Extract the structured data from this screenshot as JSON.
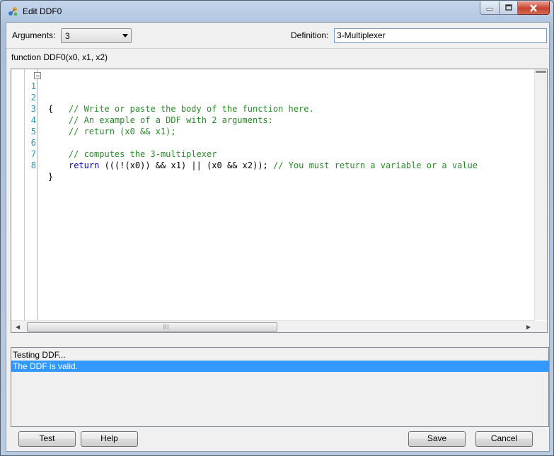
{
  "window": {
    "title": "Edit DDF0"
  },
  "arguments": {
    "label": "Arguments:",
    "value": "3"
  },
  "definition": {
    "label": "Definition:",
    "value": "3-Multiplexer"
  },
  "signature": "function DDF0(x0, x1, x2)",
  "editor": {
    "lines": [
      {
        "num": "1",
        "text": "{"
      },
      {
        "num": "2",
        "text": "    // Write or paste the body of the function here."
      },
      {
        "num": "3",
        "text": "    // An example of a DDF with 2 arguments:"
      },
      {
        "num": "4",
        "text": "    // return (x0 && x1);"
      },
      {
        "num": "5",
        "text": ""
      },
      {
        "num": "6",
        "text": "    // computes the 3-multiplexer"
      },
      {
        "num": "7",
        "keyword": "return",
        "expr": " (((!(x0)) && x1) || (x0 && x2)); ",
        "comment": "// You must return a variable or a value"
      },
      {
        "num": "8",
        "text": "}"
      }
    ]
  },
  "output": {
    "lines": [
      "Testing DDF...",
      "The DDF is valid."
    ]
  },
  "buttons": {
    "test": "Test",
    "help": "Help",
    "save": "Save",
    "cancel": "Cancel"
  },
  "colors": {
    "selection": "#3399ff",
    "comment": "#2a8a2a",
    "keyword": "#0000cc",
    "line_number": "#2b91af"
  }
}
